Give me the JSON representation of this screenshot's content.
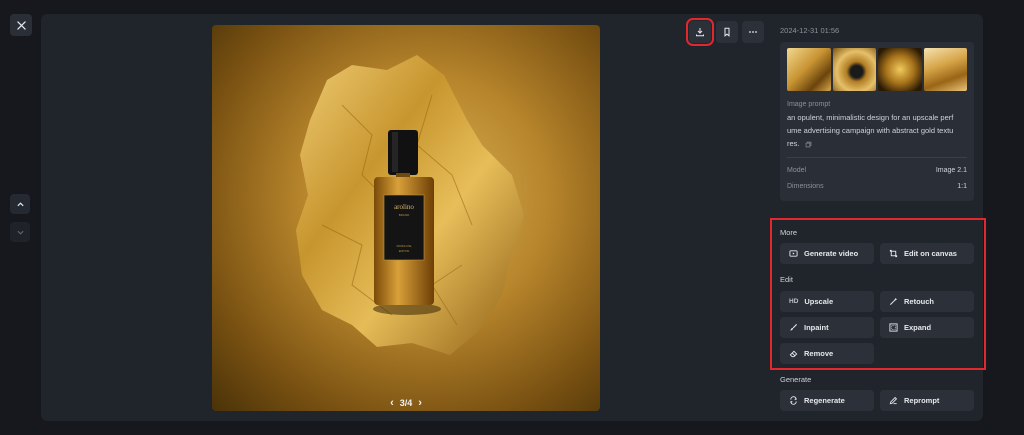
{
  "viewer": {
    "pager_text": "3/4"
  },
  "info": {
    "date": "2024-12-31 01:56",
    "prompt_label": "Image prompt",
    "prompt_lines": [
      "an opulent, minimalistic design for an upscale perf",
      "ume advertising campaign with abstract gold textu",
      "res."
    ],
    "model_label": "Model",
    "model_value": "Image 2.1",
    "dimensions_label": "Dimensions",
    "dimensions_value": "1:1"
  },
  "sections": {
    "more": "More",
    "edit": "Edit",
    "generate": "Generate"
  },
  "buttons": {
    "generate_video": "Generate video",
    "edit_on_canvas": "Edit on canvas",
    "upscale": "Upscale",
    "upscale_badge": "HD",
    "retouch": "Retouch",
    "inpaint": "Inpaint",
    "expand": "Expand",
    "remove": "Remove",
    "regenerate": "Regenerate",
    "reprompt": "Reprompt"
  },
  "bottle": {
    "brand": "arolino",
    "sub": "BRAND",
    "small1": "MONOLUXE",
    "small2": "EDITION"
  },
  "colors": {
    "accent_highlight": "#e0282e",
    "gold": "#c9972f"
  }
}
